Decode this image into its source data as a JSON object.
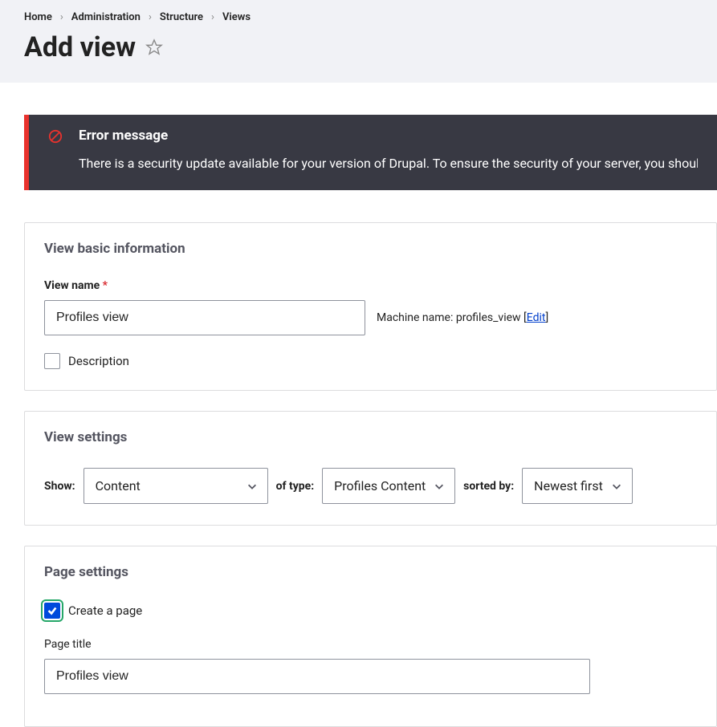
{
  "breadcrumb": [
    "Home",
    "Administration",
    "Structure",
    "Views"
  ],
  "page_title": "Add view",
  "error": {
    "title": "Error message",
    "text": "There is a security update available for your version of Drupal. To ensure the security of your server, you should"
  },
  "basic": {
    "legend": "View basic information",
    "view_name_label": "View name",
    "view_name_value": "Profiles view",
    "machine_name_label": "Machine name:",
    "machine_name_value": "profiles_view",
    "edit_link": "Edit",
    "description_label": "Description"
  },
  "view_settings": {
    "legend": "View settings",
    "show_label": "Show:",
    "show_value": "Content",
    "type_label": "of type:",
    "type_value": "Profiles Content",
    "sort_label": "sorted by:",
    "sort_value": "Newest first"
  },
  "page_settings": {
    "legend": "Page settings",
    "create_page_label": "Create a page",
    "page_title_label": "Page title",
    "page_title_value": "Profiles view"
  }
}
